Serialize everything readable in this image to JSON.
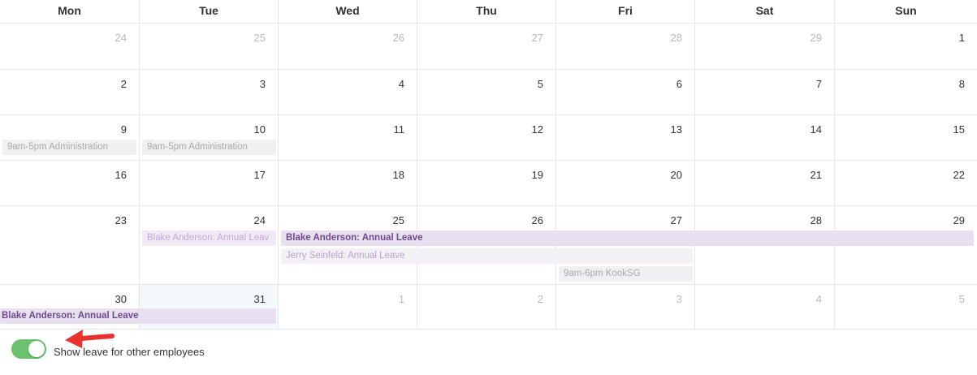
{
  "calendar": {
    "weekdays": [
      "Mon",
      "Tue",
      "Wed",
      "Thu",
      "Fri",
      "Sat",
      "Sun"
    ],
    "weeks": [
      {
        "days": [
          {
            "label": "24",
            "muted": true
          },
          {
            "label": "25",
            "muted": true
          },
          {
            "label": "26",
            "muted": true
          },
          {
            "label": "27",
            "muted": true
          },
          {
            "label": "28",
            "muted": true
          },
          {
            "label": "29",
            "muted": true
          },
          {
            "label": "1",
            "muted": false
          }
        ]
      },
      {
        "days": [
          {
            "label": "2"
          },
          {
            "label": "3"
          },
          {
            "label": "4"
          },
          {
            "label": "5"
          },
          {
            "label": "6"
          },
          {
            "label": "7"
          },
          {
            "label": "8"
          }
        ]
      },
      {
        "days": [
          {
            "label": "9"
          },
          {
            "label": "10"
          },
          {
            "label": "11"
          },
          {
            "label": "12"
          },
          {
            "label": "13"
          },
          {
            "label": "14"
          },
          {
            "label": "15"
          }
        ]
      },
      {
        "days": [
          {
            "label": "16"
          },
          {
            "label": "17"
          },
          {
            "label": "18"
          },
          {
            "label": "19"
          },
          {
            "label": "20"
          },
          {
            "label": "21"
          },
          {
            "label": "22"
          }
        ]
      },
      {
        "days": [
          {
            "label": "23"
          },
          {
            "label": "24"
          },
          {
            "label": "25"
          },
          {
            "label": "26"
          },
          {
            "label": "27"
          },
          {
            "label": "28"
          },
          {
            "label": "29"
          }
        ]
      },
      {
        "days": [
          {
            "label": "30"
          },
          {
            "label": "31",
            "today": true
          },
          {
            "label": "1",
            "muted": true
          },
          {
            "label": "2",
            "muted": true
          },
          {
            "label": "3",
            "muted": true
          },
          {
            "label": "4",
            "muted": true
          },
          {
            "label": "5",
            "muted": true
          }
        ]
      }
    ],
    "events": {
      "w3_mon": "9am-5pm Administration",
      "w3_tue": "9am-5pm Administration",
      "w5_tue_blake": "Blake Anderson: Annual Leav",
      "w5_blake": "Blake Anderson: Annual Leave",
      "w5_jerry": "Jerry Seinfeld: Annual Leave",
      "w5_kook": "9am-6pm KookSG",
      "w6_blake": "Blake Anderson: Annual Leave"
    }
  },
  "footer": {
    "toggle_on": true,
    "toggle_label": "Show leave for other employees"
  },
  "colors": {
    "toggle_on": "#6cc16f",
    "leave_event": "#e8dff0",
    "shift_event": "#f0f0f2",
    "arrow": "#e8322f"
  },
  "icons": {
    "annotation": "red-arrow-icon"
  }
}
